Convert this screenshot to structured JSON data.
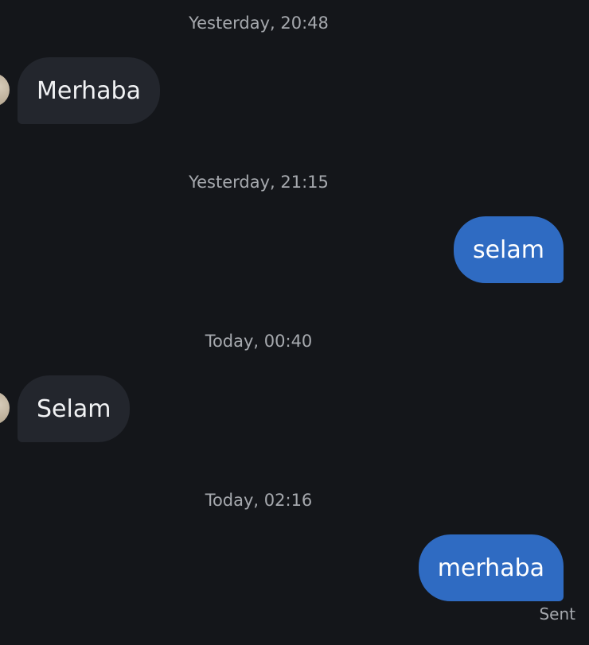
{
  "conversation": {
    "messages": [
      {
        "timestamp": "Yesterday, 20:48",
        "direction": "incoming",
        "text": "Merhaba"
      },
      {
        "timestamp": "Yesterday, 21:15",
        "direction": "outgoing",
        "text": "selam"
      },
      {
        "timestamp": "Today, 00:40",
        "direction": "incoming",
        "text": "Selam"
      },
      {
        "timestamp": "Today, 02:16",
        "direction": "outgoing",
        "text": "merhaba",
        "status": "Sent"
      }
    ]
  },
  "colors": {
    "background": "#14161a",
    "incoming_bubble": "#23262d",
    "outgoing_bubble": "#2f6bc2",
    "timestamp_text": "#a6a9ae"
  }
}
